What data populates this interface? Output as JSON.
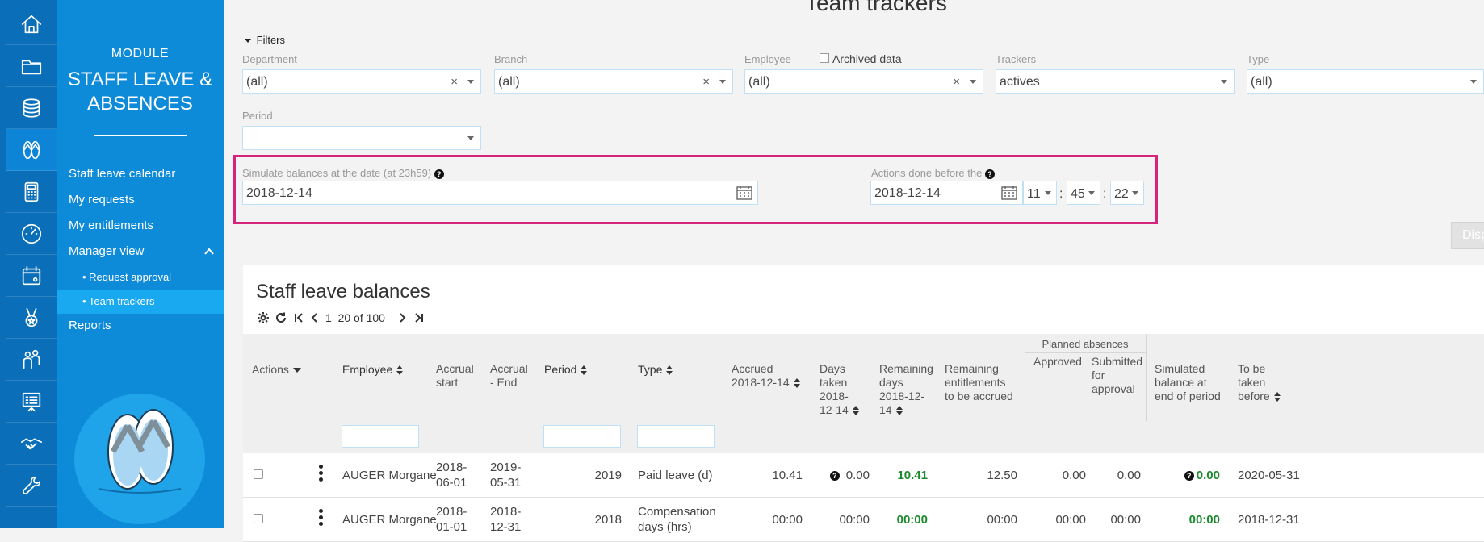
{
  "module": {
    "label": "MODULE",
    "title_line1": "STAFF LEAVE &",
    "title_line2": "ABSENCES"
  },
  "iconbar": [
    "home-icon",
    "folder-icon",
    "coins-icon",
    "flip-flops-icon",
    "calculator-icon",
    "gauge-icon",
    "calendar-icon",
    "medal-icon",
    "people-icon",
    "presentation-icon",
    "handshake-icon",
    "wrench-icon"
  ],
  "nav": {
    "items": [
      "Staff leave calendar",
      "My requests",
      "My entitlements",
      "Manager view"
    ],
    "subitems": [
      "• Request approval",
      "• Team trackers"
    ],
    "reports": "Reports"
  },
  "page": {
    "title": "Team trackers"
  },
  "filters": {
    "toggle": "Filters",
    "department_label": "Department",
    "department_value": "(all)",
    "branch_label": "Branch",
    "branch_value": "(all)",
    "employee_label": "Employee",
    "archived_label": "Archived data",
    "employee_value": "(all)",
    "trackers_label": "Trackers",
    "trackers_value": "actives",
    "type_label": "Type",
    "type_value": "(all)",
    "period_label": "Period",
    "period_value": "",
    "clear": "×"
  },
  "simulate": {
    "date_label": "Simulate balances at the date (at 23h59)",
    "date_value": "2018-12-14",
    "actions_label": "Actions done before the",
    "actions_date": "2018-12-14",
    "hour": "11",
    "minute": "45",
    "second": "22",
    "sep": ":",
    "help": "?"
  },
  "display_button": "Display",
  "table": {
    "title": "Staff leave balances",
    "pagination": "1–20 of 100",
    "headers": {
      "actions": "Actions",
      "employee": "Employee",
      "accrual_start": "Accrual start",
      "accrual_end": "Accrual - End",
      "period": "Period",
      "type": "Type",
      "accrued": "Accrued 2018-12-14",
      "days_taken": "Days taken 2018-12-14",
      "remaining_days": "Remaining days 2018-12-14",
      "remaining_entitlements": "Remaining entitlements to be accrued",
      "planned_group": "Planned absences",
      "approved": "Approved",
      "submitted": "Submitted for approval",
      "simulated": "Simulated balance at end of period",
      "to_be_taken": "To be taken before"
    },
    "rows": [
      {
        "employee": "AUGER Morgane",
        "accrual_start": "2018-06-01",
        "accrual_end": "2019-05-31",
        "period": "2019",
        "type": "Paid leave (d)",
        "accrued": "10.41",
        "days_taken": "0.00",
        "remaining_days": "10.41",
        "remaining_entitlements": "12.50",
        "approved": "0.00",
        "submitted": "0.00",
        "simulated": "0.00",
        "to_be_taken": "2020-05-31"
      },
      {
        "employee": "AUGER Morgane",
        "accrual_start": "2018-01-01",
        "accrual_end": "2018-12-31",
        "period": "2018",
        "type": "Compensation days (hrs)",
        "accrued": "00:00",
        "days_taken": "00:00",
        "remaining_days": "00:00",
        "remaining_entitlements": "00:00",
        "approved": "00:00",
        "submitted": "00:00",
        "simulated": "00:00",
        "to_be_taken": "2018-12-31"
      }
    ]
  }
}
